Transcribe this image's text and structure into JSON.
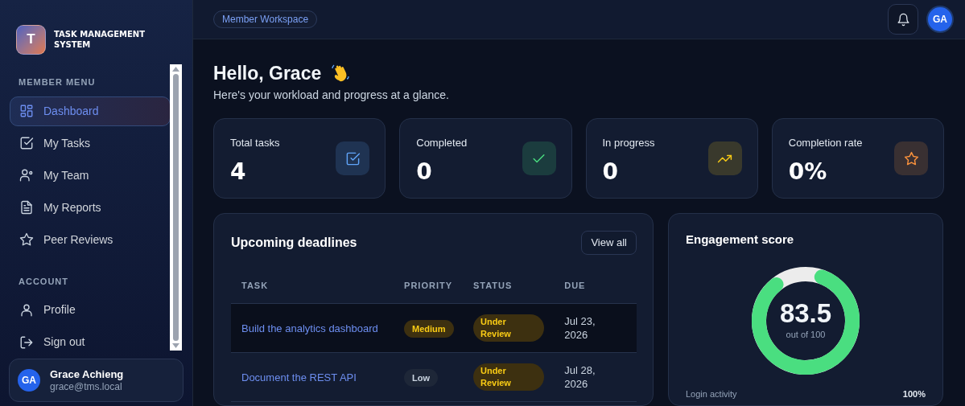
{
  "brand": {
    "logo_letter": "T",
    "name": "TASK MANAGEMENT SYSTEM"
  },
  "sidebar": {
    "sections": [
      {
        "title": "MEMBER MENU",
        "items": [
          {
            "label": "Dashboard",
            "selected": true
          },
          {
            "label": "My Tasks",
            "selected": false
          },
          {
            "label": "My Team",
            "selected": false
          },
          {
            "label": "My Reports",
            "selected": false
          },
          {
            "label": "Peer Reviews",
            "selected": false
          }
        ]
      },
      {
        "title": "ACCOUNT",
        "items": [
          {
            "label": "Profile",
            "selected": false
          },
          {
            "label": "Sign out",
            "selected": false
          }
        ]
      }
    ],
    "user": {
      "initials": "GA",
      "name": "Grace Achieng",
      "email": "grace@tms.local"
    }
  },
  "header": {
    "badge": "Member Workspace",
    "avatar_initials": "GA"
  },
  "greeting": {
    "title": "Hello, Grace",
    "subtitle": "Here's your workload and progress at a glance."
  },
  "stats": [
    {
      "label": "Total tasks",
      "value": "4",
      "color": "#60a5fa"
    },
    {
      "label": "Completed",
      "value": "0",
      "color": "#4ade80"
    },
    {
      "label": "In progress",
      "value": "0",
      "color": "#facc15"
    },
    {
      "label": "Completion rate",
      "value": "0%",
      "color": "#fb923c"
    }
  ],
  "deadlines": {
    "title": "Upcoming deadlines",
    "button": "View all",
    "columns": [
      "TASK",
      "PRIORITY",
      "STATUS",
      "DUE"
    ],
    "rows": [
      {
        "task": "Build the analytics dashboard",
        "priority": "Medium",
        "kind": "medium",
        "status": "Under Review",
        "due": "Jul 23, 2026",
        "selected": true
      },
      {
        "task": "Document the REST API",
        "priority": "Low",
        "kind": "low",
        "status": "Under Review",
        "due": "Jul 28, 2026",
        "selected": false
      }
    ]
  },
  "engagement": {
    "title": "Engagement score",
    "score": "83.5",
    "caption": "out of 100",
    "level": 0.835,
    "metrics": [
      {
        "label": "Login activity",
        "value": "100%"
      }
    ]
  }
}
